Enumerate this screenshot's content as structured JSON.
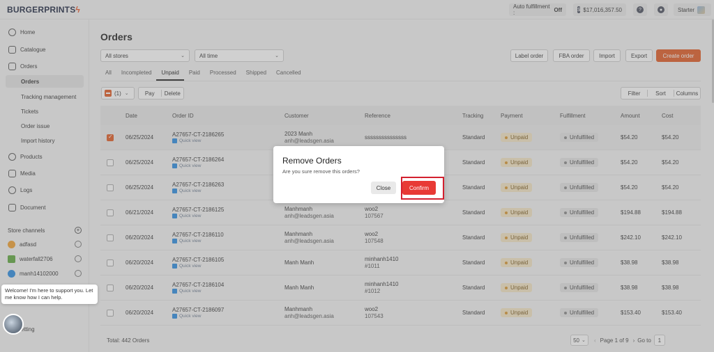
{
  "brand": {
    "name_a": "BURGER",
    "name_b": "PRINTS",
    "bolt": "ϟ"
  },
  "topbar": {
    "auto_label": "Auto fulfillment :",
    "auto_value": "Off",
    "balance": "$17,016,357.50",
    "help_icon": "question-icon",
    "bell_icon": "bell-icon",
    "user": "Starter"
  },
  "sidebar": {
    "items": [
      {
        "label": "Home",
        "icon": "home-icon"
      },
      {
        "label": "Catalogue",
        "icon": "catalogue-icon"
      },
      {
        "label": "Orders",
        "icon": "orders-icon"
      },
      {
        "label": "Orders"
      },
      {
        "label": "Tracking management"
      },
      {
        "label": "Tickets"
      },
      {
        "label": "Order issue"
      },
      {
        "label": "Import history"
      },
      {
        "label": "Products",
        "icon": "products-icon"
      },
      {
        "label": "Media",
        "icon": "media-icon"
      },
      {
        "label": "Logs",
        "icon": "logs-icon"
      },
      {
        "label": "Document",
        "icon": "document-icon"
      }
    ],
    "store_channels": "Store channels",
    "stores": [
      {
        "name": "adfasd",
        "color": "#f0a030"
      },
      {
        "name": "waterfall2706",
        "color": "#5fa83e"
      },
      {
        "name": "manh14102000",
        "color": "#2b8ce0"
      }
    ],
    "setting": "etting"
  },
  "chat": {
    "message": "Welcome! I'm here to support you. Let me know how I can help."
  },
  "main": {
    "title": "Orders",
    "filters": {
      "stores": "All stores",
      "time": "All time"
    },
    "buttons": {
      "label_order": "Label order",
      "fba_order": "FBA order",
      "import": "Import",
      "export": "Export",
      "create": "Create order"
    },
    "tabs": [
      "All",
      "Incompleted",
      "Unpaid",
      "Paid",
      "Processed",
      "Shipped",
      "Cancelled"
    ],
    "selection": {
      "count": "(1)",
      "pay": "Pay",
      "delete": "Delete"
    },
    "tools": {
      "filter": "Filter",
      "sort": "Sort",
      "columns": "Columns"
    }
  },
  "table": {
    "headers": [
      "Date",
      "Order ID",
      "Customer",
      "Reference",
      "Tracking",
      "Payment",
      "Fulfillment",
      "Amount",
      "Cost"
    ],
    "quick_view": "Quick view",
    "rows": [
      {
        "checked": true,
        "date": "06/25/2024",
        "id": "A27657-CT-2186265",
        "customer": "2023 Manh",
        "email": "anh@leadsgen.asia",
        "ref": "sssssssssssssss",
        "ref2": "",
        "tracking": "Standard",
        "payment": "Unpaid",
        "fulfillment": "Unfulfilled",
        "amount": "$54.20",
        "cost": "$54.20"
      },
      {
        "checked": false,
        "date": "06/25/2024",
        "id": "A27657-CT-2186264",
        "customer": "",
        "email": "",
        "ref": "",
        "ref2": "",
        "tracking": "Standard",
        "payment": "Unpaid",
        "fulfillment": "Unfulfilled",
        "amount": "$54.20",
        "cost": "$54.20"
      },
      {
        "checked": false,
        "date": "06/25/2024",
        "id": "A27657-CT-2186263",
        "customer": "",
        "email": "",
        "ref": "",
        "ref2": "",
        "tracking": "Standard",
        "payment": "Unpaid",
        "fulfillment": "Unfulfilled",
        "amount": "$54.20",
        "cost": "$54.20"
      },
      {
        "checked": false,
        "date": "06/21/2024",
        "id": "A27657-CT-2186125",
        "customer": "Manhmanh",
        "email": "anh@leadsgen.asia",
        "ref": "woo2",
        "ref2": "107567",
        "tracking": "Standard",
        "payment": "Unpaid",
        "fulfillment": "Unfulfilled",
        "amount": "$194.88",
        "cost": "$194.88"
      },
      {
        "checked": false,
        "date": "06/20/2024",
        "id": "A27657-CT-2186110",
        "customer": "Manhmanh",
        "email": "anh@leadsgen.asia",
        "ref": "woo2",
        "ref2": "107548",
        "tracking": "Standard",
        "payment": "Unpaid",
        "fulfillment": "Unfulfilled",
        "amount": "$242.10",
        "cost": "$242.10"
      },
      {
        "checked": false,
        "date": "06/20/2024",
        "id": "A27657-CT-2186105",
        "customer": "Manh Manh",
        "email": "",
        "ref": "minhanh1410",
        "ref2": "#1011",
        "tracking": "Standard",
        "payment": "Unpaid",
        "fulfillment": "Unfulfilled",
        "amount": "$38.98",
        "cost": "$38.98"
      },
      {
        "checked": false,
        "date": "06/20/2024",
        "id": "A27657-CT-2186104",
        "customer": "Manh Manh",
        "email": "",
        "ref": "minhanh1410",
        "ref2": "#1012",
        "tracking": "Standard",
        "payment": "Unpaid",
        "fulfillment": "Unfulfilled",
        "amount": "$38.98",
        "cost": "$38.98"
      },
      {
        "checked": false,
        "date": "06/20/2024",
        "id": "A27657-CT-2186097",
        "customer": "Manhmanh",
        "email": "anh@leadsgen.asia",
        "ref": "woo2",
        "ref2": "107543",
        "tracking": "Standard",
        "payment": "Unpaid",
        "fulfillment": "Unfulfilled",
        "amount": "$153.40",
        "cost": "$153.40"
      }
    ]
  },
  "footer": {
    "total": "Total: 442 Orders",
    "per_page": "50",
    "page_text": "Page 1 of 9",
    "goto": "Go to",
    "goto_value": "1"
  },
  "modal": {
    "title": "Remove Orders",
    "message": "Are you sure remove this orders?",
    "close": "Close",
    "confirm": "Confirm"
  },
  "colors": {
    "accent": "#e05a23",
    "confirm": "#e83a35",
    "highlight": "#d3202f"
  }
}
